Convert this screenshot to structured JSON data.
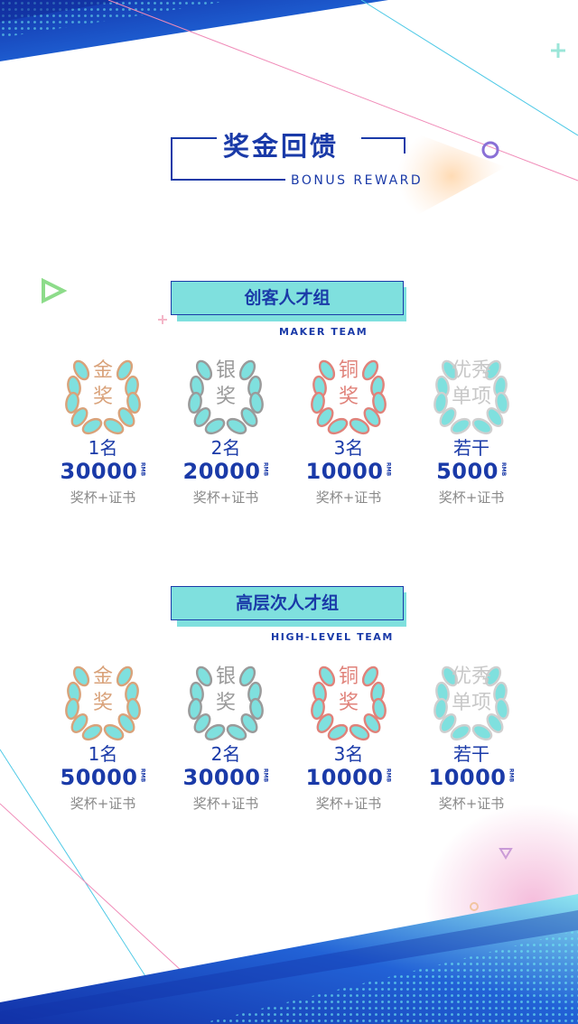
{
  "header": {
    "title_zh": "奖金回馈",
    "title_en": "BONUS REWARD"
  },
  "colors": {
    "accent": "#1a3aa8",
    "teal": "#7fe0de",
    "gold": "#d9a27a",
    "silver": "#9a9a9a",
    "bronze": "#e0827a",
    "excellent": "#c8c8c8"
  },
  "groups": [
    {
      "label": "创客人才组",
      "label_en": "MAKER TEAM",
      "awards": [
        {
          "name_line1": "金",
          "name_line2": "奖",
          "icon": "laurel-wreath-gold-icon",
          "count": "1名",
          "amount": "30000",
          "currency": "RMB",
          "prize": "奖杯+证书"
        },
        {
          "name_line1": "银",
          "name_line2": "奖",
          "icon": "laurel-wreath-silver-icon",
          "count": "2名",
          "amount": "20000",
          "currency": "RMB",
          "prize": "奖杯+证书"
        },
        {
          "name_line1": "铜",
          "name_line2": "奖",
          "icon": "laurel-wreath-bronze-icon",
          "count": "3名",
          "amount": "10000",
          "currency": "RMB",
          "prize": "奖杯+证书"
        },
        {
          "name_line1": "优秀",
          "name_line2": "单项",
          "icon": "laurel-wreath-excellent-icon",
          "count": "若干",
          "amount": "5000",
          "currency": "RMB",
          "prize": "奖杯+证书"
        }
      ]
    },
    {
      "label": "高层次人才组",
      "label_en": "HIGH-LEVEL TEAM",
      "awards": [
        {
          "name_line1": "金",
          "name_line2": "奖",
          "icon": "laurel-wreath-gold-icon",
          "count": "1名",
          "amount": "50000",
          "currency": "RMB",
          "prize": "奖杯+证书"
        },
        {
          "name_line1": "银",
          "name_line2": "奖",
          "icon": "laurel-wreath-silver-icon",
          "count": "2名",
          "amount": "30000",
          "currency": "RMB",
          "prize": "奖杯+证书"
        },
        {
          "name_line1": "铜",
          "name_line2": "奖",
          "icon": "laurel-wreath-bronze-icon",
          "count": "3名",
          "amount": "10000",
          "currency": "RMB",
          "prize": "奖杯+证书"
        },
        {
          "name_line1": "优秀",
          "name_line2": "单项",
          "icon": "laurel-wreath-excellent-icon",
          "count": "若干",
          "amount": "10000",
          "currency": "RMB",
          "prize": "奖杯+证书"
        }
      ]
    }
  ]
}
